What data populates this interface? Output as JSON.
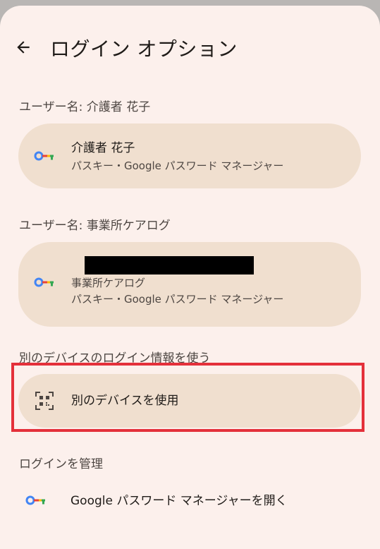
{
  "header": {
    "back_icon": "arrow-left-icon",
    "title": "ログイン オプション"
  },
  "sections": {
    "user1": {
      "label": "ユーザー名: 介護者 花子",
      "card": {
        "icon": "passkey-icon",
        "title": "介護者 花子",
        "subtitle": "パスキー・Google パスワード マネージャー"
      }
    },
    "user2": {
      "label": "ユーザー名: 事業所ケアログ",
      "card": {
        "icon": "passkey-icon",
        "line1": "事業所ケアログ",
        "subtitle": "パスキー・Google パスワード マネージャー"
      }
    },
    "other_device": {
      "label": "別のデバイスのログイン情報を使う",
      "card": {
        "icon": "qr-scan-icon",
        "title": "別のデバイスを使用"
      }
    },
    "manage": {
      "label": "ログインを管理",
      "row": {
        "icon": "passkey-icon",
        "title": "Google パスワード マネージャーを開く"
      }
    }
  },
  "colors": {
    "background": "#fcf0ec",
    "card": "#f0dfcf",
    "highlight": "#e4303a",
    "key_blue": "#4285f4",
    "key_red": "#ea4335",
    "key_yellow": "#fbbc04",
    "key_green": "#34a853"
  }
}
